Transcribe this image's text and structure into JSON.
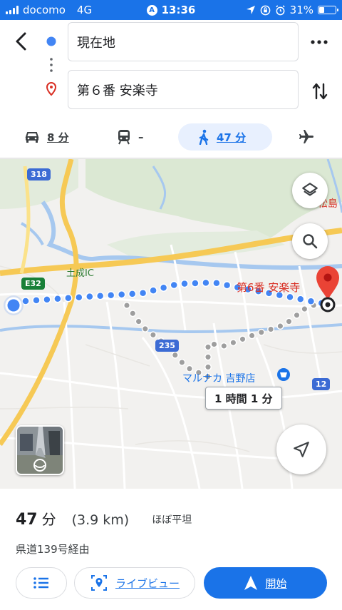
{
  "status_bar": {
    "carrier": "docomo",
    "network": "4G",
    "time": "13:36",
    "battery": "31%",
    "battery_level": 0.31
  },
  "directions": {
    "origin": "現在地",
    "destination": "第６番 安楽寺"
  },
  "travel_modes": [
    {
      "icon": "car-icon",
      "label": "8 分"
    },
    {
      "icon": "train-icon",
      "label": "–"
    },
    {
      "icon": "walk-icon",
      "label": "47 分",
      "selected": true
    },
    {
      "icon": "airplane-icon",
      "label": ""
    }
  ],
  "map": {
    "route_shields": [
      "318",
      "235",
      "12",
      "E32"
    ],
    "interchange_label": "土成IC",
    "shop_label": "マルナカ 吉野店",
    "destination_label": "第6番 安楽寺",
    "edge_label": "松島",
    "alt_route_duration": "1 時間 1 分"
  },
  "summary": {
    "time": "47",
    "time_unit": "分",
    "distance": "(3.9 km)",
    "terrain": "ほぼ平坦",
    "via": "県道139号経由"
  },
  "actions": {
    "steps_icon": "list-icon",
    "live_view": "ライブビュー",
    "start": "開始"
  },
  "colors": {
    "accent": "#1a73e8",
    "destination_pin": "#ea4335",
    "route_dots": "#4285f4",
    "alt_route_dots": "#9e9e9e",
    "selected_mode_bg": "#e8f0fe"
  }
}
